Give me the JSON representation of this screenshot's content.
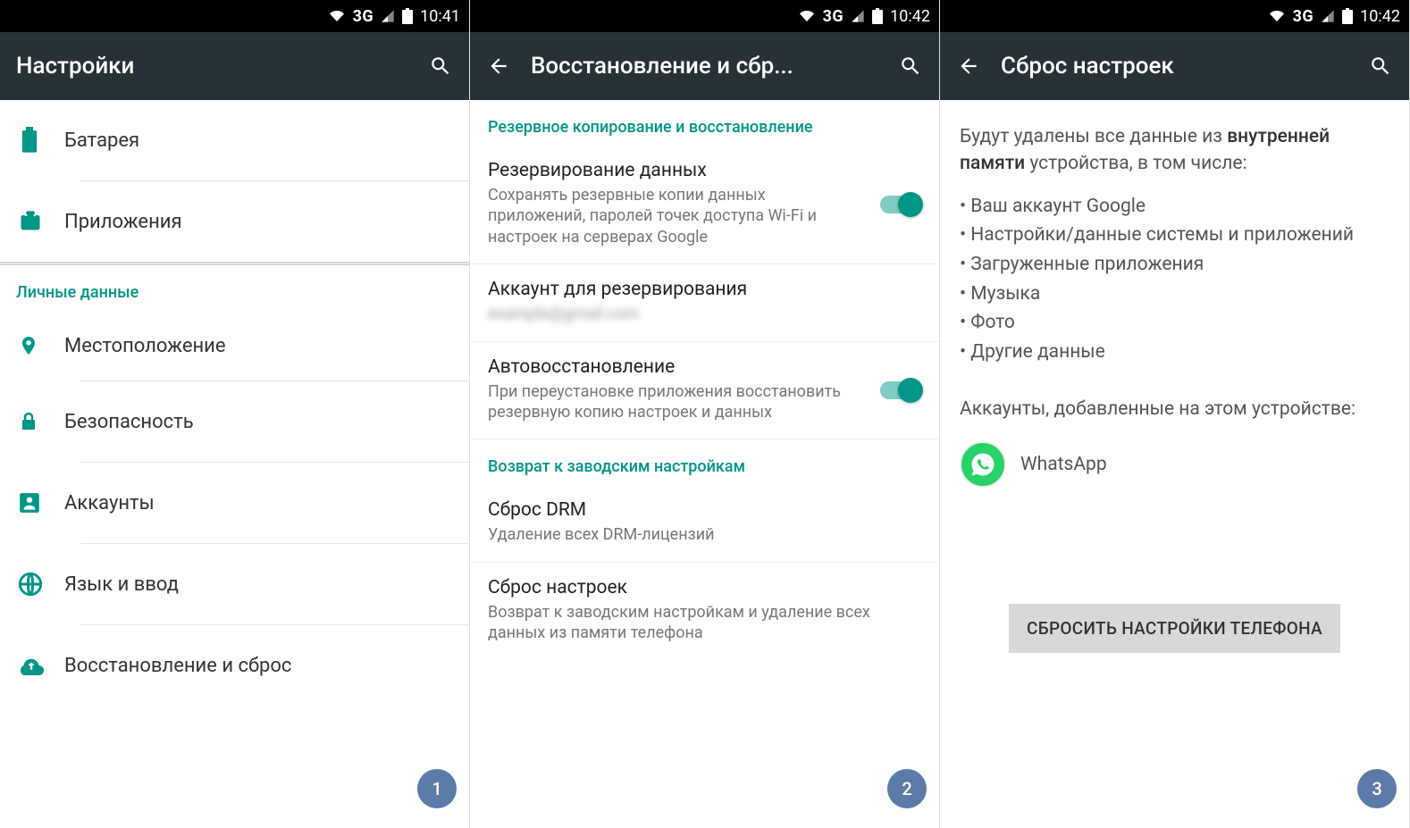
{
  "status": {
    "network": "3G",
    "time1": "10:41",
    "time2": "10:42",
    "time3": "10:42"
  },
  "badges": {
    "b1": "1",
    "b2": "2",
    "b3": "3"
  },
  "screen1": {
    "title": "Настройки",
    "items_top": [
      {
        "label": "Батарея",
        "icon": "battery"
      },
      {
        "label": "Приложения",
        "icon": "apps"
      }
    ],
    "section": "Личные данные",
    "items_personal": [
      {
        "label": "Местоположение",
        "icon": "location"
      },
      {
        "label": "Безопасность",
        "icon": "lock"
      },
      {
        "label": "Аккаунты",
        "icon": "account"
      },
      {
        "label": "Язык и ввод",
        "icon": "globe"
      },
      {
        "label": "Восстановление и сброс",
        "icon": "cloud"
      }
    ]
  },
  "screen2": {
    "title": "Восстановление и сбр...",
    "section1": "Резервное копирование и восстановление",
    "item1": {
      "t": "Резервирование данных",
      "s": "Сохранять резервные копии данных приложений, паролей точек доступа Wi-Fi и настроек на серверах Google"
    },
    "item2": {
      "t": "Аккаунт для резервирования",
      "s": "example@gmail.com"
    },
    "item3": {
      "t": "Автовосстановление",
      "s": "При переустановке приложения восстановить резервную копию настроек и данных"
    },
    "section2": "Возврат к заводским настройкам",
    "item4": {
      "t": "Сброс DRM",
      "s": "Удаление всех DRM-лицензий"
    },
    "item5": {
      "t": "Сброс настроек",
      "s": "Возврат к заводским настройкам и удаление всех данных из памяти телефона"
    }
  },
  "screen3": {
    "title": "Сброс настроек",
    "intro_a": "Будут удалены все данные из ",
    "intro_b": "внутренней памяти",
    "intro_c": " устройства, в том числе:",
    "bullets": [
      "Ваш аккаунт Google",
      "Настройки/данные системы и приложений",
      "Загруженные приложения",
      "Музыка",
      "Фото",
      "Другие данные"
    ],
    "accounts_label": "Аккаунты, добавленные на этом устройстве:",
    "account": "WhatsApp",
    "button": "СБРОСИТЬ НАСТРОЙКИ ТЕЛЕФОНА"
  }
}
